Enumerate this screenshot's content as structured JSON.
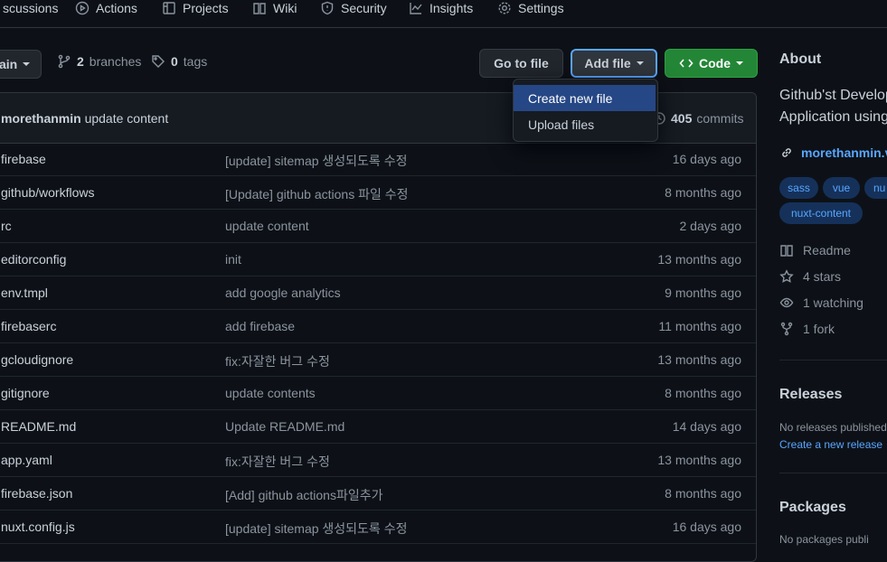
{
  "nav": {
    "items": [
      {
        "label": "scussions",
        "icon": "discussions-icon"
      },
      {
        "label": "Actions",
        "icon": "play-icon"
      },
      {
        "label": "Projects",
        "icon": "table-icon"
      },
      {
        "label": "Wiki",
        "icon": "book-icon"
      },
      {
        "label": "Security",
        "icon": "shield-icon"
      },
      {
        "label": "Insights",
        "icon": "graph-icon"
      },
      {
        "label": "Settings",
        "icon": "gear-icon"
      }
    ]
  },
  "toolbar": {
    "branch_label": "ain",
    "branches_count": "2",
    "branches_label": "branches",
    "tags_count": "0",
    "tags_label": "tags",
    "go_to_file": "Go to file",
    "add_file": "Add file",
    "code": "Code"
  },
  "dropdown": {
    "items": [
      "Create new file",
      "Upload files"
    ]
  },
  "commit": {
    "author": "morethanmin",
    "message": "update content",
    "count": "405",
    "count_label": "commits"
  },
  "files": [
    {
      "name": "firebase",
      "message": "[update] sitemap 생성되도록 수정",
      "age": "16 days ago"
    },
    {
      "name": "github/workflows",
      "message": "[Update] github actions 파일 수정",
      "age": "8 months ago"
    },
    {
      "name": "rc",
      "message": "update content",
      "age": "2 days ago"
    },
    {
      "name": "editorconfig",
      "message": "init",
      "age": "13 months ago"
    },
    {
      "name": "env.tmpl",
      "message": "add google analytics",
      "age": "9 months ago"
    },
    {
      "name": "firebaserc",
      "message": "add firebase",
      "age": "11 months ago"
    },
    {
      "name": "gcloudignore",
      "message": "fix:자잘한 버그 수정",
      "age": "13 months ago"
    },
    {
      "name": "gitignore",
      "message": "update contents",
      "age": "8 months ago"
    },
    {
      "name": "README.md",
      "message": "Update README.md",
      "age": "14 days ago"
    },
    {
      "name": "app.yaml",
      "message": "fix:자잘한 버그 수정",
      "age": "13 months ago"
    },
    {
      "name": "firebase.json",
      "message": "[Add] github actions파일추가",
      "age": "8 months ago"
    },
    {
      "name": "nuxt.config.js",
      "message": "[update] sitemap 생성되도록 수정",
      "age": "16 days ago"
    }
  ],
  "sidebar": {
    "about_title": "About",
    "description_line1": "Github'st Develop",
    "description_line2": "Application using",
    "link": "morethanmin.v",
    "topics": [
      "sass",
      "vue",
      "nu",
      "nuxt-content"
    ],
    "readme": "Readme",
    "stars": "4 stars",
    "watching": "1 watching",
    "forks": "1 fork",
    "releases_title": "Releases",
    "no_releases": "No releases published",
    "create_release": "Create a new release",
    "packages_title": "Packages",
    "packages_text": "No packages publi"
  },
  "colors": {
    "background": "#0d1117",
    "accent": "#58a6ff",
    "code_button": "#238636",
    "menu_active": "#264785"
  }
}
